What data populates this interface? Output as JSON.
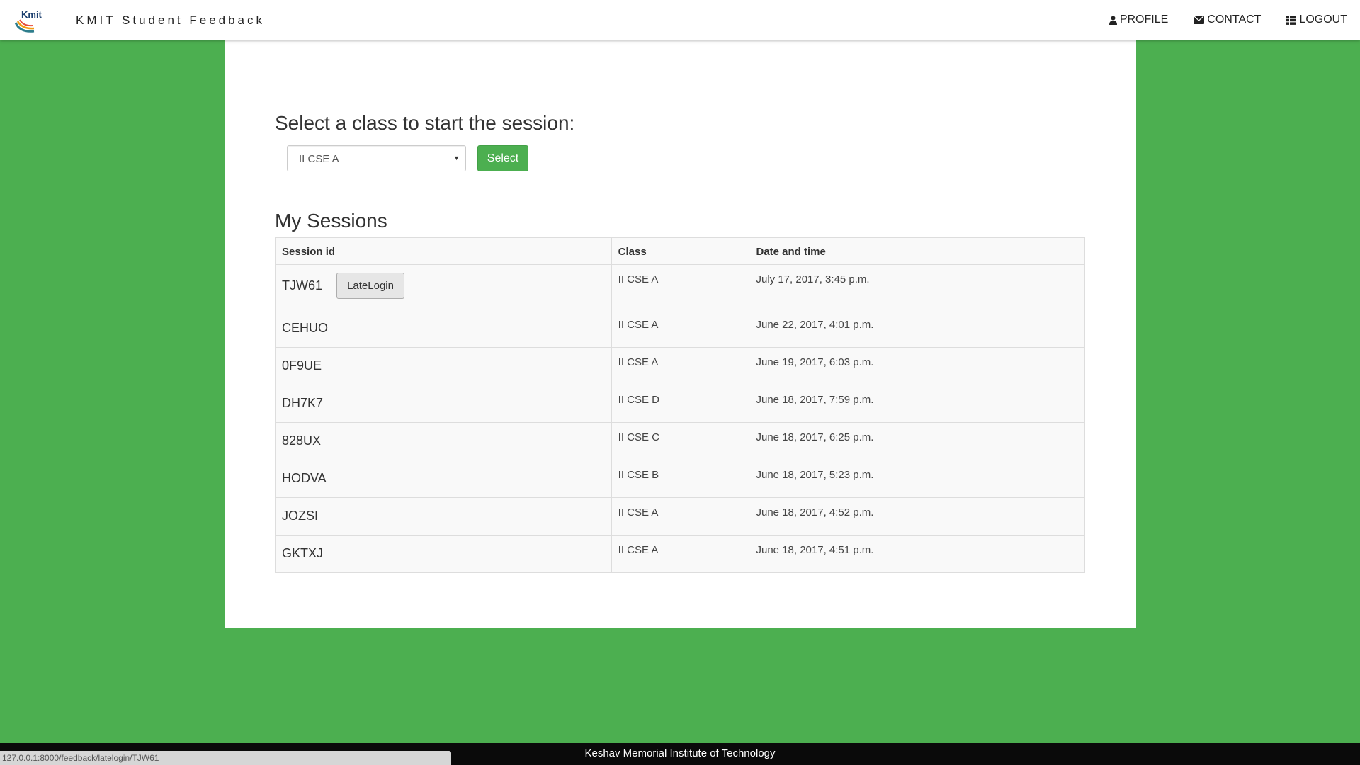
{
  "header": {
    "logo_text": "Kmit",
    "brand": "KMIT Student Feedback",
    "nav": [
      {
        "label": "PROFILE",
        "icon": "user-icon"
      },
      {
        "label": "CONTACT",
        "icon": "envelope-icon"
      },
      {
        "label": "LOGOUT",
        "icon": "grid-icon"
      }
    ]
  },
  "main": {
    "select_heading": "Select a class to start the session:",
    "class_select": {
      "value": "II CSE A"
    },
    "select_button": "Select",
    "sessions_heading": "My Sessions",
    "table": {
      "columns": [
        "Session id",
        "Class",
        "Date and time"
      ],
      "late_login_label": "LateLogin",
      "rows": [
        {
          "id": "TJW61",
          "class": "II CSE A",
          "datetime": "July 17, 2017, 3:45 p.m."
        },
        {
          "id": "CEHUO",
          "class": "II CSE A",
          "datetime": "June 22, 2017, 4:01 p.m."
        },
        {
          "id": "0F9UE",
          "class": "II CSE A",
          "datetime": "June 19, 2017, 6:03 p.m."
        },
        {
          "id": "DH7K7",
          "class": "II CSE D",
          "datetime": "June 18, 2017, 7:59 p.m."
        },
        {
          "id": "828UX",
          "class": "II CSE C",
          "datetime": "June 18, 2017, 6:25 p.m."
        },
        {
          "id": "HODVA",
          "class": "II CSE B",
          "datetime": "June 18, 2017, 5:23 p.m."
        },
        {
          "id": "JOZSI",
          "class": "II CSE A",
          "datetime": "June 18, 2017, 4:52 p.m."
        },
        {
          "id": "GKTXJ",
          "class": "II CSE A",
          "datetime": "June 18, 2017, 4:51 p.m."
        }
      ]
    }
  },
  "footer": {
    "text": "Keshav Memorial Institute of Technology"
  },
  "status_bar": {
    "url": "127.0.0.1:8000/feedback/latelogin/TJW61"
  },
  "colors": {
    "accent": "#4caf50",
    "footer": "#0a0a0a",
    "panel": "#ffffff"
  }
}
